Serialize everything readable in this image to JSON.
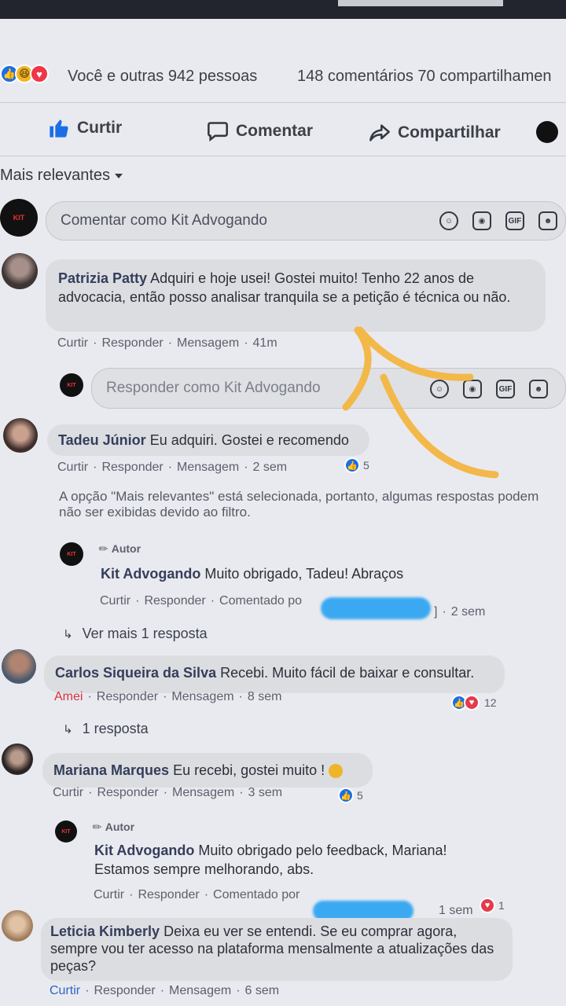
{
  "post_stats": {
    "reactions_text": "Você e outras 942 pessoas",
    "comments_shares_text": "148 comentários  70 compartilhamen"
  },
  "actions": {
    "like": "Curtir",
    "comment": "Comentar",
    "share": "Compartilhar"
  },
  "sort": {
    "label": "Mais relevantes"
  },
  "comment_input": {
    "placeholder": "Comentar como Kit Advogando"
  },
  "reply_input": {
    "placeholder": "Responder como Kit Advogando"
  },
  "comments": [
    {
      "author": "Patrizia Patty",
      "text": "Adquiri e hoje usei! Gostei muito! Tenho 22 anos de advocacia, então posso analisar tranquila se a petição é técnica ou não.",
      "like": "Curtir",
      "reply": "Responder",
      "message": "Mensagem",
      "time": "41m"
    },
    {
      "author": "Tadeu Júnior",
      "text": "Eu adquiri. Gostei e recomendo",
      "like": "Curtir",
      "reply": "Responder",
      "message": "Mensagem",
      "time": "2 sem",
      "reactions": "5"
    },
    {
      "author": "Carlos Siqueira da Silva",
      "text": "Recebi. Muito fácil de baixar e consultar.",
      "like": "Amei",
      "reply": "Responder",
      "message": "Mensagem",
      "time": "8 sem",
      "reactions": "12"
    },
    {
      "author": "Mariana Marques",
      "text": "Eu recebi, gostei muito !",
      "like": "Curtir",
      "reply": "Responder",
      "message": "Mensagem",
      "time": "3 sem",
      "reactions": "5"
    },
    {
      "author": "Leticia Kimberly",
      "text": "Deixa eu ver se entendi. Se eu comprar agora, sempre vou ter acesso na plataforma mensalmente a atualizações das peças?",
      "like": "Curtir",
      "reply": "Responder",
      "message": "Mensagem",
      "time": "6 sem"
    }
  ],
  "filter_notice": "A opção \"Mais relevantes\" está selecionada, portanto, algumas respostas podem não ser exibidas devido ao filtro.",
  "replies": [
    {
      "badge": "Autor",
      "author": "Kit Advogando",
      "text": "Muito obrigado, Tadeu! Abraços",
      "like": "Curtir",
      "reply": "Responder",
      "commented_by": "Comentado po",
      "time": "2 sem"
    },
    {
      "badge": "Autor",
      "author": "Kit Advogando",
      "text": "Muito obrigado pelo feedback, Mariana! Estamos sempre melhorando, abs.",
      "like": "Curtir",
      "reply": "Responder",
      "commented_by": "Comentado por",
      "time": "1 sem",
      "reactions": "1"
    }
  ],
  "more_replies": {
    "tadeu": "Ver mais 1 resposta",
    "carlos": "1 resposta"
  },
  "colors": {
    "annotation": "#f3b84a",
    "redaction": "#3aa9f2",
    "like_blue": "#1b6ee8",
    "love_red": "#e43b4a"
  }
}
